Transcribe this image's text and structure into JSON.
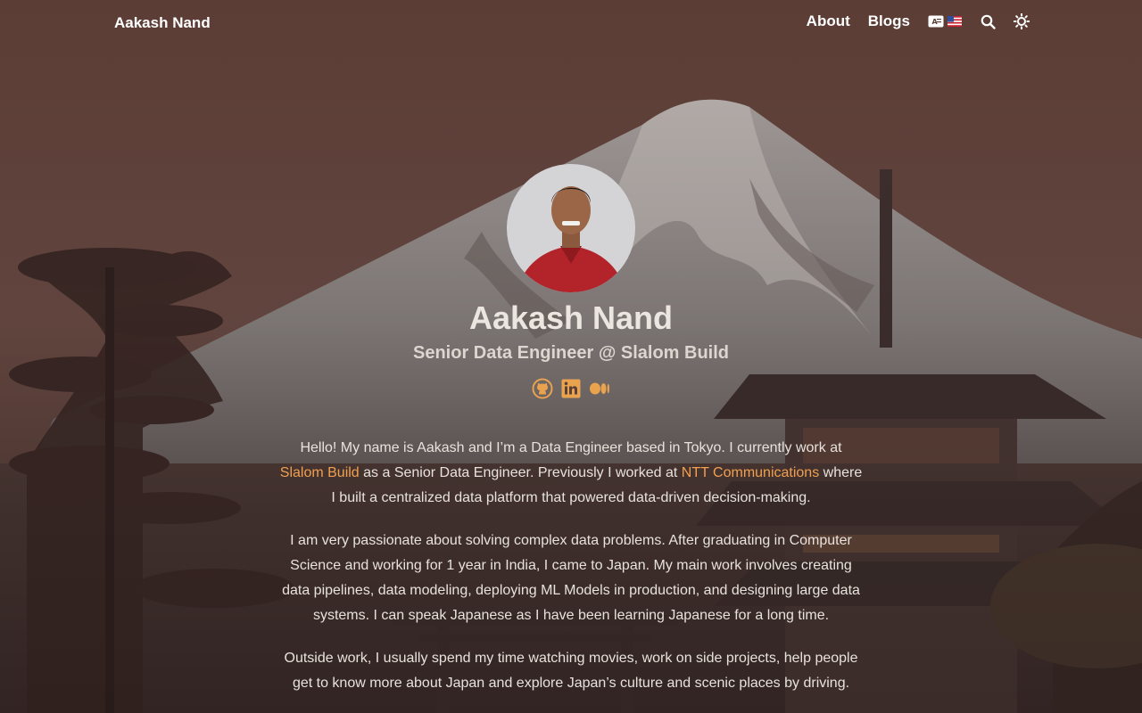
{
  "nav": {
    "brand": "Aakash Nand",
    "links": [
      "About",
      "Blogs"
    ],
    "language_icons": [
      "translate-icon",
      "us-flag-icon"
    ],
    "search_icon": "search-icon",
    "theme_icon": "sun-icon"
  },
  "profile": {
    "name": "Aakash Nand",
    "title": "Senior Data Engineer @ Slalom Build",
    "social_icons": [
      "github-icon",
      "linkedin-icon",
      "medium-icon"
    ]
  },
  "bio": {
    "p1_a": "Hello! My name is Aakash and I’m a Data Engineer based in Tokyo. I currently work at ",
    "p1_link1": "Slalom Build",
    "p1_b": " as a Senior Data Engineer. Previously I worked at ",
    "p1_link2": "NTT Communications",
    "p1_c": " where I built a centralized data platform that powered data-driven decision-making.",
    "p2": "I am very passionate about solving complex data problems. After graduating in Computer Science and working for 1 year in India, I came to Japan. My main work involves creating data pipelines, data modeling, deploying ML Models in production, and designing large data systems. I can speak Japanese as I have been learning Japanese for a long time.",
    "p3": "Outside work, I usually spend my time watching movies, work on side projects, help people get to know more about Japan and explore Japan’s culture and scenic places by driving."
  },
  "colors": {
    "accent": "#f0a050",
    "background": "#5a4038"
  }
}
